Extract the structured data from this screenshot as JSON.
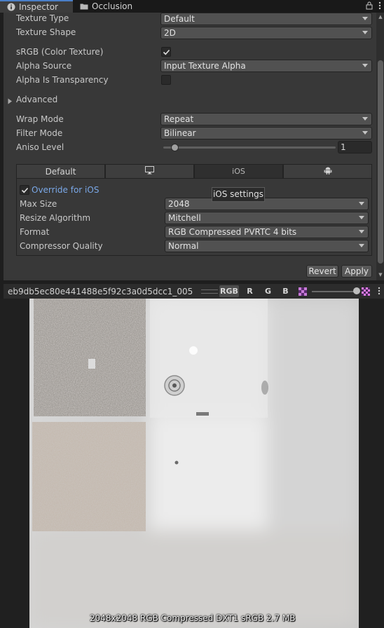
{
  "tabs": [
    {
      "label": "Inspector",
      "icon": "info-icon"
    },
    {
      "label": "Occlusion",
      "icon": "folder-icon"
    }
  ],
  "fields": {
    "texture_type": {
      "label": "Texture Type",
      "value": "Default"
    },
    "texture_shape": {
      "label": "Texture Shape",
      "value": "2D"
    },
    "srgb": {
      "label": "sRGB (Color Texture)",
      "checked": true
    },
    "alpha_source": {
      "label": "Alpha Source",
      "value": "Input Texture Alpha"
    },
    "alpha_transparency": {
      "label": "Alpha Is Transparency",
      "checked": false
    },
    "advanced": {
      "label": "Advanced"
    },
    "wrap_mode": {
      "label": "Wrap Mode",
      "value": "Repeat"
    },
    "filter_mode": {
      "label": "Filter Mode",
      "value": "Bilinear"
    },
    "aniso_level": {
      "label": "Aniso Level",
      "value": "1",
      "slider_level": 0.0625
    }
  },
  "platform": {
    "tabs": [
      "Default",
      "",
      "iOS",
      ""
    ],
    "tab_icons": [
      "",
      "monitor-icon",
      "",
      "android-icon"
    ],
    "override": {
      "label": "Override for iOS",
      "checked": true
    },
    "tooltip": "iOS settings",
    "max_size": {
      "label": "Max Size",
      "value": "2048"
    },
    "resize_algorithm": {
      "label": "Resize Algorithm",
      "value": "Mitchell"
    },
    "format": {
      "label": "Format",
      "value": "RGB Compressed PVRTC 4 bits"
    },
    "compressor_quality": {
      "label": "Compressor Quality",
      "value": "Normal"
    }
  },
  "buttons": {
    "revert": "Revert",
    "apply": "Apply"
  },
  "preview": {
    "asset_name": "eb9db5ec80e441488e5f92c3a0d5dcc1_005",
    "channels": [
      "RGB",
      "R",
      "G",
      "B"
    ],
    "status": "2048x2048  RGB Compressed DXT1 sRGB   2.7 MB",
    "mip_level": 0.98
  },
  "colors": {
    "accent": "#4a7fc8",
    "override_text": "#7aa8e8"
  }
}
